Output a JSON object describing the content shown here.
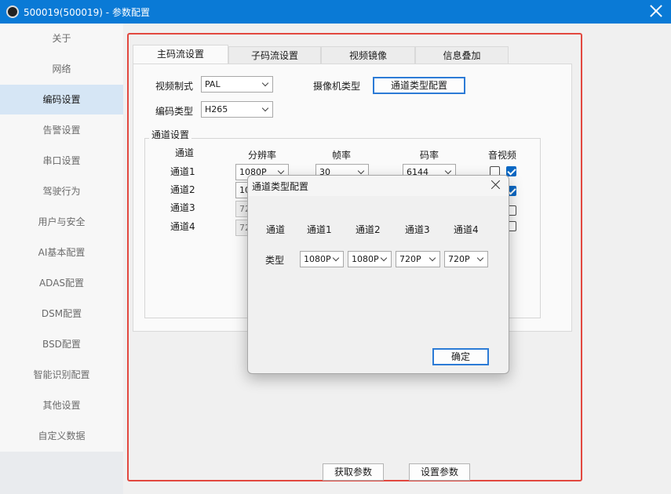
{
  "window": {
    "title": "500019(500019) - 参数配置"
  },
  "sidebar": {
    "items": [
      {
        "label": "关于"
      },
      {
        "label": "网络"
      },
      {
        "label": "编码设置"
      },
      {
        "label": "告警设置"
      },
      {
        "label": "串口设置"
      },
      {
        "label": "驾驶行为"
      },
      {
        "label": "用户与安全"
      },
      {
        "label": "AI基本配置"
      },
      {
        "label": "ADAS配置"
      },
      {
        "label": "DSM配置"
      },
      {
        "label": "BSD配置"
      },
      {
        "label": "智能识别配置"
      },
      {
        "label": "其他设置"
      },
      {
        "label": "自定义数据"
      }
    ],
    "active_index": 2
  },
  "tabs": [
    {
      "label": "主码流设置"
    },
    {
      "label": "子码流设置"
    },
    {
      "label": "视频镜像"
    },
    {
      "label": "信息叠加"
    }
  ],
  "main": {
    "video_format_label": "视频制式",
    "video_format_value": "PAL",
    "encode_type_label": "编码类型",
    "encode_type_value": "H265",
    "camera_type_label": "摄像机类型",
    "channel_type_button": "通道类型配置",
    "group_title": "通道设置",
    "columns": {
      "channel": "通道",
      "resolution": "分辨率",
      "framerate": "帧率",
      "bitrate": "码率",
      "av": "音视频"
    },
    "rows": [
      {
        "name": "通道1",
        "resolution": "1080P",
        "framerate": "30",
        "bitrate": "6144"
      },
      {
        "name": "通道2",
        "resolution": "10"
      },
      {
        "name": "通道3",
        "resolution": "72"
      },
      {
        "name": "通道4",
        "resolution": "72"
      }
    ]
  },
  "dialog": {
    "title": "通道类型配置",
    "headers": [
      "通道",
      "通道1",
      "通道2",
      "通道3",
      "通道4"
    ],
    "type_label": "类型",
    "values": [
      "1080P",
      "1080P",
      "720P",
      "720P"
    ],
    "ok_button": "确定"
  },
  "footer": {
    "get_params": "获取参数",
    "set_params": "设置参数"
  },
  "colors": {
    "titlebar": "#0a7ad6",
    "frame_border": "#e2483f",
    "accent": "#0a68c4"
  }
}
